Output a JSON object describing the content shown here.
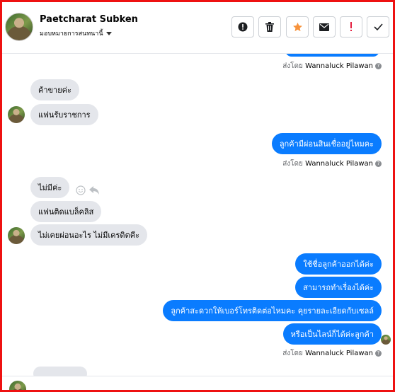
{
  "header": {
    "contact_name": "Paetcharat Subken",
    "assign_label": "มอบหมายการสนทนานี้",
    "toolbar": [
      {
        "name": "alert-circle-button",
        "icon": "exclamation-circle-icon"
      },
      {
        "name": "delete-button",
        "icon": "trash-icon"
      },
      {
        "name": "star-button",
        "icon": "star-icon",
        "color": "#f7923b"
      },
      {
        "name": "email-button",
        "icon": "envelope-icon"
      },
      {
        "name": "flag-spam-button",
        "icon": "exclamation-icon",
        "color": "#e41e3f"
      },
      {
        "name": "mark-done-button",
        "icon": "checkmark-icon"
      }
    ]
  },
  "messages": {
    "sent_by_prefix": "ส่งโดย",
    "sent_by_name": "Wannaluck Pilawan",
    "incoming_1": "ค้าขายค่ะ",
    "incoming_2": "แฟนรับราชการ",
    "outgoing_1": "ลูกค้ามีผ่อนสินเชื่ออยู่ไหมคะ",
    "incoming_3": "ไม่มีค่ะ",
    "incoming_4": "แฟนติดแบล็คลิส",
    "incoming_5": "ไม่เคยผ่อนอะไร ไม่มีเครดิตคีะ",
    "outgoing_2": "ใช้ชื่อลูกค้าออกได้ค่ะ",
    "outgoing_3": "สามารถทำเรื่องได้ค่ะ",
    "outgoing_4": "ลูกค้าสะดวกให้เบอร์โทรติดต่อไหมคะ คุยรายละเอียดกับเซลล์",
    "outgoing_5": "หรือเป็นไลน์ก็ได้ค่ะลูกค้า"
  },
  "colors": {
    "outgoing_bubble": "#0a7cff",
    "incoming_bubble": "#e4e6eb",
    "frame_border": "#ee1111"
  }
}
